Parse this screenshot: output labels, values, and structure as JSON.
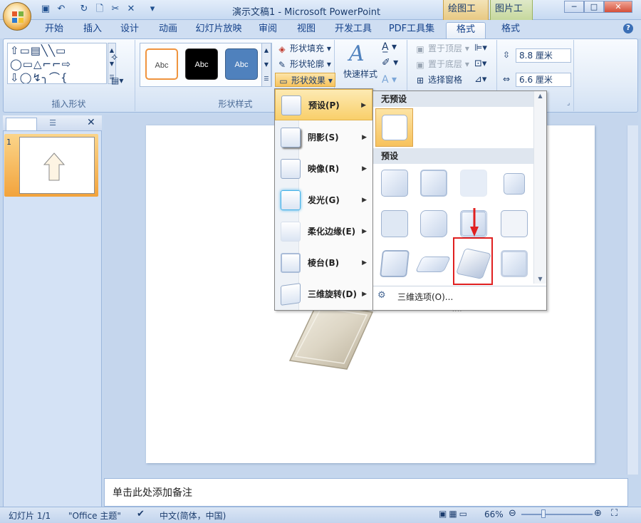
{
  "window": {
    "title": "演示文稿1 - Microsoft PowerPoint",
    "context_tabs": [
      "绘图工具",
      "图片工具"
    ],
    "controls": [
      "─",
      "□",
      "✕"
    ]
  },
  "ribbon": {
    "tabs": [
      "开始",
      "插入",
      "设计",
      "动画",
      "幻灯片放映",
      "审阅",
      "视图",
      "开发工具",
      "PDF工具集",
      "格式",
      "格式"
    ],
    "active_tab_index": 9,
    "groups": {
      "insert_shapes": {
        "label": "插入形状"
      },
      "shape_styles": {
        "label": "形状样式",
        "style_sample": "Abc",
        "fill": "形状填充",
        "outline": "形状轮廓",
        "effects": "形状效果"
      },
      "wordart": {
        "quick_styles": "快速样式"
      },
      "arrange": {
        "bring_front": "置于顶层",
        "send_back": "置于底层",
        "selection_pane": "选择窗格"
      },
      "size": {
        "height": "8.8 厘米",
        "width": "6.6 厘米"
      }
    }
  },
  "effects_menu": {
    "items": [
      {
        "label": "预设(P)",
        "active": true
      },
      {
        "label": "阴影(S)"
      },
      {
        "label": "映像(R)"
      },
      {
        "label": "发光(G)"
      },
      {
        "label": "柔化边缘(E)"
      },
      {
        "label": "棱台(B)"
      },
      {
        "label": "三维旋转(D)"
      }
    ]
  },
  "preset_submenu": {
    "no_preset_header": "无预设",
    "preset_header": "预设",
    "preset_count": 12,
    "selected_preset_index": 10,
    "footer_option": "三维选项(O)..."
  },
  "slides_pane": {
    "slide_number": "1"
  },
  "notes": {
    "placeholder": "单击此处添加备注"
  },
  "status": {
    "slide": "幻灯片 1/1",
    "theme": "\"Office 主题\"",
    "language": "中文(简体，中国)",
    "zoom": "66%"
  },
  "colors": {
    "accent": "#15428b",
    "highlight": "#e02020",
    "active_menu": "#f9cf6a"
  }
}
